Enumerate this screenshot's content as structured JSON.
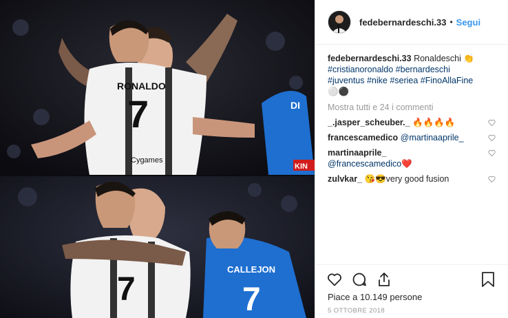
{
  "post": {
    "username": "fedebernardeschi.33",
    "separator": "•",
    "follow_label": "Segui",
    "caption": {
      "username": "fedebernardeschi.33",
      "text": "Ronaldeschi",
      "emoji": "👏",
      "tags_line1": "#cristianoronaldo #bernardeschi",
      "tags_line2": "#juventus #nike #seriea #FinoAllaFine",
      "emoji_line": "⚪⚫"
    },
    "view_all_comments": "Mostra tutti e 24 i commenti",
    "comments": [
      {
        "user": "_.jasper_scheuber._",
        "text": "🔥🔥🔥🔥"
      },
      {
        "user": "francescamedico",
        "mention": "@martinaaprile_",
        "text": ""
      },
      {
        "user": "martinaaprile_",
        "mention": "@francescamedico",
        "text": "❤️"
      },
      {
        "user": "zulvkar_",
        "text": "😘😎very good fusion"
      }
    ],
    "likes": "Piace a 10.149 persone",
    "date": "5 OTTOBRE 2018",
    "photo_top": {
      "jersey_name": "RONALDO",
      "jersey_number": "7",
      "sponsor": "Cygames",
      "opponent_text": "KIN"
    },
    "photo_bottom": {
      "jersey_number": "7",
      "opponent_name": "CALLEJON",
      "opponent_number": "7"
    }
  },
  "colors": {
    "link": "#003569",
    "follow": "#3897f0",
    "muted": "#999999",
    "border": "#efefef"
  }
}
